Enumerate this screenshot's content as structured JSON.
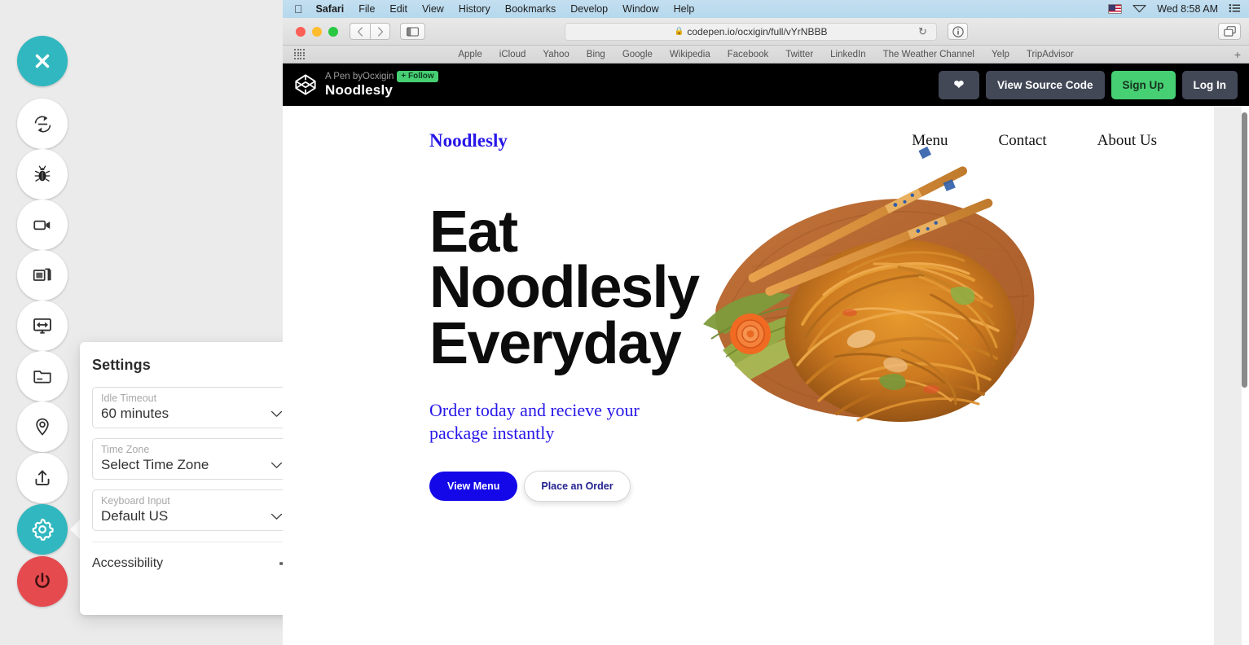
{
  "dock": {
    "buttons": [
      {
        "name": "close-session-button",
        "icon": "close-icon",
        "style": "teal"
      },
      {
        "name": "restart-button",
        "icon": "refresh-arrows-icon",
        "style": "white"
      },
      {
        "name": "debug-button",
        "icon": "bug-icon",
        "style": "white"
      },
      {
        "name": "record-button",
        "icon": "video-camera-icon",
        "style": "white"
      },
      {
        "name": "screenshot-button",
        "icon": "copy-images-icon",
        "style": "white"
      },
      {
        "name": "resolution-button",
        "icon": "monitor-resize-icon",
        "style": "white"
      },
      {
        "name": "files-button",
        "icon": "folder-icon",
        "style": "white"
      },
      {
        "name": "location-button",
        "icon": "map-pin-icon",
        "style": "white"
      },
      {
        "name": "upload-button",
        "icon": "upload-icon",
        "style": "white"
      },
      {
        "name": "settings-button",
        "icon": "gear-icon",
        "style": "teal"
      },
      {
        "name": "power-button",
        "icon": "power-icon",
        "style": "red"
      }
    ]
  },
  "settings": {
    "title": "Settings",
    "fields": [
      {
        "label": "Idle Timeout",
        "value": "60 minutes"
      },
      {
        "label": "Time Zone",
        "value": "Select Time Zone"
      },
      {
        "label": "Keyboard Input",
        "value": "Default US"
      }
    ],
    "accessibility_label": "Accessibility",
    "accessibility_icon": "plus-icon"
  },
  "macos": {
    "apple_menu_icon": "apple-logo-icon",
    "menus": [
      "Safari",
      "File",
      "Edit",
      "View",
      "History",
      "Bookmarks",
      "Develop",
      "Window",
      "Help"
    ],
    "status": {
      "flag_icon": "us-flag-icon",
      "wifi_icon": "wifi-icon",
      "clock": "Wed 8:58 AM",
      "list_icon": "control-center-icon"
    }
  },
  "browser": {
    "back_icon": "chevron-left-icon",
    "forward_icon": "chevron-right-icon",
    "sidebar_icon": "sidebar-icon",
    "lock_icon": "lock-icon",
    "url": "codepen.io/ocxigin/full/vYrNBBB",
    "reload_icon": "reload-icon",
    "info_icon": "info-icon",
    "tab_overview_icon": "tab-overview-icon",
    "apps_grid_icon": "apps-grid-icon",
    "new_tab_icon": "plus-icon",
    "bookmarks": [
      "Apple",
      "iCloud",
      "Yahoo",
      "Bing",
      "Google",
      "Wikipedia",
      "Facebook",
      "Twitter",
      "LinkedIn",
      "The Weather Channel",
      "Yelp",
      "TripAdvisor"
    ]
  },
  "codepen": {
    "logo_icon": "codepen-logo-icon",
    "author_line": "A Pen byOcxigin",
    "follow_label": "+ Follow",
    "pen_title": "Noodlesly",
    "heart_icon": "heart-icon",
    "view_source_label": "View Source Code",
    "sign_up_label": "Sign Up",
    "log_in_label": "Log In",
    "accent_green": "#47cf73",
    "button_gray": "#434857"
  },
  "site": {
    "brand": "Noodlesly",
    "nav": [
      "Menu",
      "Contact",
      "About Us"
    ],
    "headline_lines": [
      "Eat",
      "Noodlesly",
      "Everyday"
    ],
    "subhead": "Order today and recieve your package instantly",
    "primary_cta": "View Menu",
    "secondary_cta": "Place an Order",
    "brand_color": "#2717e8",
    "hero_image_alt": "noodles-on-wooden-leaf-plate-with-chopsticks"
  }
}
